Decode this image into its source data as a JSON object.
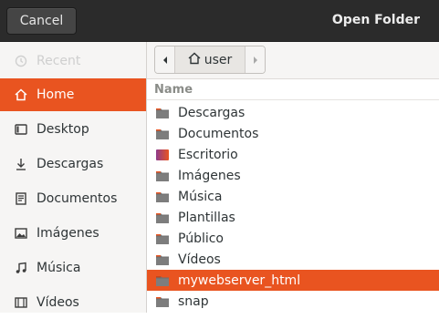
{
  "header": {
    "cancel_label": "Cancel",
    "title": "Open Folder"
  },
  "sidebar": {
    "items": [
      {
        "label": "Recent",
        "icon": "clock-icon"
      },
      {
        "label": "Home",
        "icon": "home-icon"
      },
      {
        "label": "Desktop",
        "icon": "desktop-icon"
      },
      {
        "label": "Descargas",
        "icon": "download-icon"
      },
      {
        "label": "Documentos",
        "icon": "document-icon"
      },
      {
        "label": "Imágenes",
        "icon": "image-icon"
      },
      {
        "label": "Música",
        "icon": "music-icon"
      },
      {
        "label": "Vídeos",
        "icon": "video-icon"
      }
    ]
  },
  "pathbar": {
    "current": "user"
  },
  "list": {
    "column_name": "Name",
    "rows": [
      {
        "name": "Descargas"
      },
      {
        "name": "Documentos"
      },
      {
        "name": "Escritorio"
      },
      {
        "name": "Imágenes"
      },
      {
        "name": "Música"
      },
      {
        "name": "Plantillas"
      },
      {
        "name": "Público"
      },
      {
        "name": "Vídeos"
      },
      {
        "name": "mywebserver_html"
      },
      {
        "name": "snap"
      }
    ]
  },
  "colors": {
    "accent": "#e95420",
    "header_bg": "#2b2b2b",
    "sidebar_bg": "#f6f5f4"
  }
}
